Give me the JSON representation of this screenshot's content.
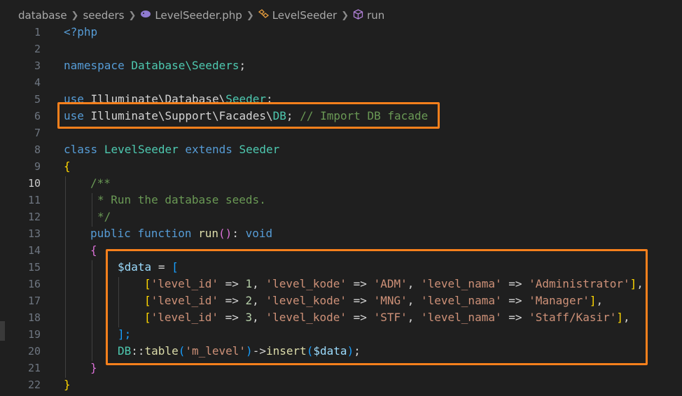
{
  "breadcrumb": {
    "items": [
      "database",
      "seeders",
      "LevelSeeder.php",
      "LevelSeeder",
      "run"
    ],
    "icons": [
      "php-elephant-icon",
      "class-icon",
      "method-cube-icon"
    ]
  },
  "colors": {
    "background": "#1f1f1f",
    "highlight_border": "#f7801c",
    "keyword": "#569cd6",
    "type": "#4ec9b0",
    "string": "#ce9178",
    "comment": "#6a9955",
    "variable": "#9cdcfe",
    "function": "#dcdcaa"
  },
  "editor": {
    "active_line": 10,
    "line_numbers": [
      "1",
      "2",
      "3",
      "4",
      "5",
      "6",
      "7",
      "8",
      "9",
      "10",
      "11",
      "12",
      "13",
      "14",
      "15",
      "16",
      "17",
      "18",
      "19",
      "20",
      "21",
      "22"
    ],
    "code": {
      "l1": "<?php",
      "l3_kw": "namespace",
      "l3_ns": "Database\\Seeders",
      "l3_end": ";",
      "l5_kw": "use",
      "l5_ns": "Illuminate\\Database\\",
      "l5_cls": "Seeder",
      "l5_end": ";",
      "l6_kw": "use",
      "l6_ns": "Illuminate\\Support\\Facades\\",
      "l6_cls": "DB",
      "l6_end": ";",
      "l6_comment": "// Import DB facade",
      "l8_kw1": "class",
      "l8_cls": "LevelSeeder",
      "l8_kw2": "extends",
      "l8_parent": "Seeder",
      "l9": "{",
      "l10": "/**",
      "l11": "* Run the database seeds.",
      "l12": "*/",
      "l13_kw1": "public",
      "l13_kw2": "function",
      "l13_fn": "run",
      "l13_p": "()",
      "l13_colon": ":",
      "l13_ret": "void",
      "l14": "{",
      "l15_var": "$data",
      "l15_op": "=",
      "l15_br": "[",
      "rows": [
        {
          "k1": "'level_id'",
          "v1": "1",
          "k2": "'level_kode'",
          "v2": "'ADM'",
          "k3": "'level_nama'",
          "v3": "'Administrator'"
        },
        {
          "k1": "'level_id'",
          "v1": "2",
          "k2": "'level_kode'",
          "v2": "'MNG'",
          "k3": "'level_nama'",
          "v3": "'Manager'"
        },
        {
          "k1": "'level_id'",
          "v1": "3",
          "k2": "'level_kode'",
          "v2": "'STF'",
          "k3": "'level_nama'",
          "v3": "'Staff/Kasir'"
        }
      ],
      "arrow": "=>",
      "l19": "];",
      "l20_cls": "DB",
      "l20_sep": "::",
      "l20_fn1": "table",
      "l20_arg": "'m_level'",
      "l20_arrow": "->",
      "l20_fn2": "insert",
      "l20_var": "$data",
      "l20_end": ";",
      "l21": "}",
      "l22": "}"
    }
  }
}
